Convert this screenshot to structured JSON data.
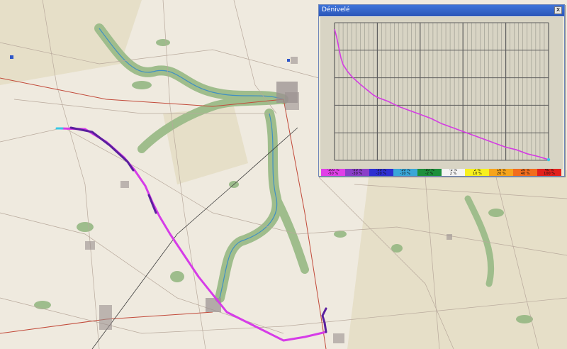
{
  "window": {
    "title": "Dénivelé",
    "close_label": "x"
  },
  "colors": {
    "route_main": "#d63ce8",
    "route_dark": "#5b1f9e",
    "route_start": "#38c8e6",
    "profile_line": "#d43ce3",
    "plot_bg": "#d8d4c4",
    "grid": "#5e5e5e"
  },
  "chart_data": {
    "type": "line",
    "title": "",
    "xlabel": "",
    "ylabel": "",
    "x": [
      0,
      1,
      2,
      3,
      4,
      6,
      8,
      10,
      12,
      15,
      18,
      20,
      25,
      30,
      35,
      40,
      45,
      50,
      55,
      60,
      65,
      70,
      75,
      80,
      85,
      90,
      95,
      98,
      100
    ],
    "y": [
      100,
      94,
      86,
      78,
      73,
      68,
      64,
      61,
      58,
      54,
      50,
      48,
      45,
      41,
      38,
      35,
      32,
      28,
      25,
      22,
      19,
      16,
      13,
      10,
      8,
      5,
      3,
      1.5,
      0.5
    ],
    "xlim": [
      0,
      100
    ],
    "ylim": [
      0,
      105
    ],
    "grid": true,
    "end_marker_color": "#38c8e6"
  },
  "legend": [
    {
      "top": "-100 %",
      "bottom": "-50 %",
      "color": "#e040e8"
    },
    {
      "top": "-50 %",
      "bottom": "-30 %",
      "color": "#8a3fc9"
    },
    {
      "top": "-30 %",
      "bottom": "-20 %",
      "color": "#2d2fd1"
    },
    {
      "top": "-20 %",
      "bottom": "-10 %",
      "color": "#3aa6d8"
    },
    {
      "top": "-10 %",
      "bottom": "-2 %",
      "color": "#1d8f3c"
    },
    {
      "top": "-2 %",
      "bottom": "2 %",
      "color": "#f4f4f4"
    },
    {
      "top": "2 %",
      "bottom": "10 %",
      "color": "#f7f020"
    },
    {
      "top": "10 %",
      "bottom": "20 %",
      "color": "#f6a41d"
    },
    {
      "top": "20 %",
      "bottom": "40 %",
      "color": "#f26d1d"
    },
    {
      "top": "40 %",
      "bottom": "100 %",
      "color": "#e3201d"
    }
  ]
}
